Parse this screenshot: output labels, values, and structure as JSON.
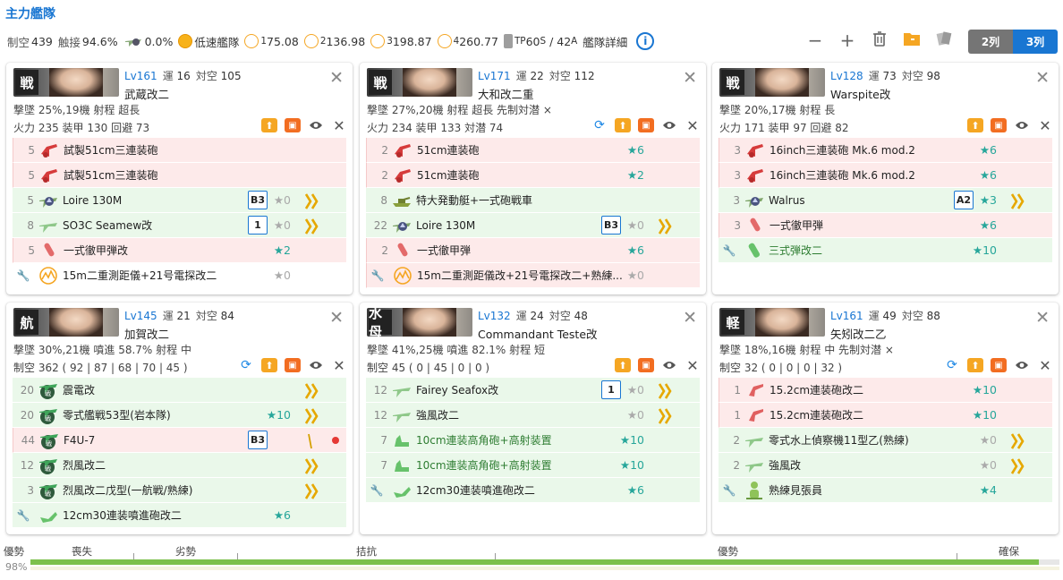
{
  "title": "主力艦隊",
  "stats": {
    "seikuu_label": "制空",
    "seikuu": "439",
    "shokusetsu_label": "触接",
    "shokusetsu": "94.6%",
    "bakuso": "0.0%",
    "speed": "低速艦隊",
    "los1_sub": "1",
    "los1": "75.08",
    "los2_sub": "2",
    "los2": "136.98",
    "los3_sub": "3",
    "los3": "198.87",
    "los4_sub": "4",
    "los4": "260.77",
    "tp_label": "TP",
    "tp_val": "60",
    "tp_s": "S",
    "tp_sep": "/ 42",
    "tp_a": "A",
    "detail": "艦隊詳細",
    "info": "i"
  },
  "toolbar": {
    "minus": "−",
    "plus": "+",
    "trash": "🗑",
    "folder": "📁",
    "cards": "▮"
  },
  "columns": {
    "c2": "2列",
    "c3": "3列"
  },
  "ships": [
    {
      "badge": "戦",
      "lv": "Lv161",
      "un_label": "運",
      "un": "16",
      "aa_label": "対空",
      "aa": "105",
      "name": "武蔵改二",
      "row2": "撃墜 25%,19機  射程 超長",
      "row3": "火力 235  装甲 130  回避 73",
      "equips": [
        {
          "cnt": "5",
          "name": "試製51cm三連装砲",
          "star": "",
          "tag": ""
        },
        {
          "cnt": "5",
          "name": "試製51cm三連装砲",
          "star": "",
          "tag": ""
        },
        {
          "cnt": "5",
          "name": "Loire 130M",
          "star": "★0",
          "tag": "B3"
        },
        {
          "cnt": "8",
          "name": "SO3C Seamew改",
          "star": "★0",
          "tag": "1"
        },
        {
          "cnt": "5",
          "name": "一式徹甲弾改",
          "star": "★2",
          "tag": ""
        },
        {
          "cnt": "",
          "name": "15m二重測距儀+21号電探改二",
          "star": "★0",
          "tag": ""
        }
      ]
    },
    {
      "badge": "戦",
      "lv": "Lv171",
      "un_label": "運",
      "un": "22",
      "aa_label": "対空",
      "aa": "112",
      "name": "大和改二重",
      "row2": "撃墜 27%,20機  射程 超長  先制対潜 ×",
      "row3": "火力 234  装甲 133  対潜 74",
      "equips": [
        {
          "cnt": "2",
          "name": "51cm連装砲",
          "star": "★6",
          "tag": ""
        },
        {
          "cnt": "2",
          "name": "51cm連装砲",
          "star": "★2",
          "tag": ""
        },
        {
          "cnt": "8",
          "name": "特大発動艇+一式砲戦車",
          "star": "",
          "tag": ""
        },
        {
          "cnt": "22",
          "name": "Loire 130M",
          "star": "★0",
          "tag": "B3"
        },
        {
          "cnt": "2",
          "name": "一式徹甲弾",
          "star": "★6",
          "tag": ""
        },
        {
          "cnt": "",
          "name": "15m二重測距儀改+21号電探改二+熟練...",
          "star": "★0",
          "tag": ""
        }
      ]
    },
    {
      "badge": "戦",
      "lv": "Lv128",
      "un_label": "運",
      "un": "73",
      "aa_label": "対空",
      "aa": "98",
      "name": "Warspite改",
      "row2": "撃墜 20%,17機  射程 長",
      "row3": "火力 171  装甲 97  回避 82",
      "equips": [
        {
          "cnt": "3",
          "name": "16inch三連装砲 Mk.6 mod.2",
          "star": "★6",
          "tag": ""
        },
        {
          "cnt": "3",
          "name": "16inch三連装砲 Mk.6 mod.2",
          "star": "★6",
          "tag": ""
        },
        {
          "cnt": "3",
          "name": "Walrus",
          "star": "★3",
          "tag": "A2"
        },
        {
          "cnt": "3",
          "name": "一式徹甲弾",
          "star": "★6",
          "tag": ""
        },
        {
          "cnt": "",
          "name": "三式弾改二",
          "star": "★10",
          "tag": ""
        }
      ]
    },
    {
      "badge": "航",
      "lv": "Lv145",
      "un_label": "運",
      "un": "21",
      "aa_label": "対空",
      "aa": "84",
      "name": "加賀改二",
      "row2": "撃墜 30%,21機  噴進 58.7%  射程 中",
      "row3": "制空 362 ( 92 | 87 | 68 | 70 | 45 )",
      "equips": [
        {
          "cnt": "20",
          "name": "震電改",
          "star": "",
          "tag": ""
        },
        {
          "cnt": "20",
          "name": "零式艦戦53型(岩本隊)",
          "star": "★10",
          "tag": ""
        },
        {
          "cnt": "44",
          "name": "F4U-7",
          "star": "",
          "tag": "B3"
        },
        {
          "cnt": "12",
          "name": "烈風改二",
          "star": "",
          "tag": ""
        },
        {
          "cnt": "3",
          "name": "烈風改二戊型(一航戦/熟練)",
          "star": "",
          "tag": ""
        },
        {
          "cnt": "",
          "name": "12cm30連装噴進砲改二",
          "star": "★6",
          "tag": ""
        }
      ]
    },
    {
      "badge": "水母",
      "lv": "Lv132",
      "un_label": "運",
      "un": "24",
      "aa_label": "対空",
      "aa": "48",
      "name": "Commandant Teste改",
      "row2": "撃墜 41%,25機  噴進 82.1%  射程 短",
      "row3": "制空 45 ( 0 | 45 | 0 | 0 )",
      "equips": [
        {
          "cnt": "12",
          "name": "Fairey Seafox改",
          "star": "★0",
          "tag": "1"
        },
        {
          "cnt": "12",
          "name": "強風改二",
          "star": "★0",
          "tag": ""
        },
        {
          "cnt": "7",
          "name": "10cm連装高角砲+高射装置",
          "star": "★10",
          "tag": ""
        },
        {
          "cnt": "7",
          "name": "10cm連装高角砲+高射装置",
          "star": "★10",
          "tag": ""
        },
        {
          "cnt": "",
          "name": "12cm30連装噴進砲改二",
          "star": "★6",
          "tag": ""
        }
      ]
    },
    {
      "badge": "軽",
      "lv": "Lv161",
      "un_label": "運",
      "un": "49",
      "aa_label": "対空",
      "aa": "88",
      "name": "矢矧改二乙",
      "row2": "撃墜 18%,16機  射程 中  先制対潜 ×",
      "row3": "制空 32 ( 0 | 0 | 0 | 32 )",
      "equips": [
        {
          "cnt": "1",
          "name": "15.2cm連装砲改二",
          "star": "★10",
          "tag": ""
        },
        {
          "cnt": "1",
          "name": "15.2cm連装砲改二",
          "star": "★10",
          "tag": ""
        },
        {
          "cnt": "2",
          "name": "零式水上偵察機11型乙(熟練)",
          "star": "★0",
          "tag": ""
        },
        {
          "cnt": "2",
          "name": "強風改",
          "star": "★0",
          "tag": ""
        },
        {
          "cnt": "",
          "name": "熟練見張員",
          "star": "★4",
          "tag": ""
        }
      ]
    }
  ],
  "gauge": {
    "label": "優勢",
    "percent": "98%",
    "fill_fraction": 0.98,
    "segments": [
      "喪失",
      "劣勢",
      "拮抗",
      "優勢",
      "確保"
    ]
  },
  "colors": {
    "accent": "#1976d2",
    "red_row": "#fdeaea",
    "green_row": "#eaf8ea",
    "gauge": "#7cc04c",
    "star": "#26a69a"
  }
}
